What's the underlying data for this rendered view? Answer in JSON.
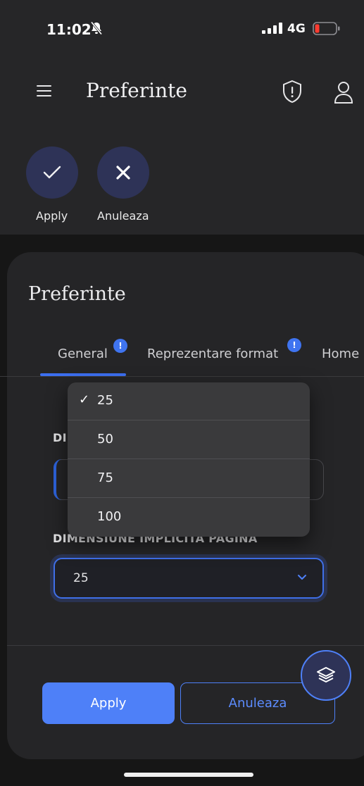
{
  "status_bar": {
    "time": "11:02",
    "network": "4G",
    "bell_icon": "bell-slash-icon",
    "battery_color": "#ff3b30"
  },
  "header": {
    "title": "Preferinte",
    "menu_icon": "hamburger-icon",
    "shield_icon": "shield-exclamation-icon",
    "user_icon": "user-icon"
  },
  "actions": [
    {
      "label": "Apply",
      "icon": "checkmark-icon"
    },
    {
      "label": "Anuleaza",
      "icon": "close-icon"
    }
  ],
  "card": {
    "title": "Preferinte",
    "tabs": [
      {
        "label": "General",
        "badge": "!",
        "active": true
      },
      {
        "label": "Reprezentare format",
        "badge": "!",
        "active": false
      },
      {
        "label": "Home",
        "badge": "",
        "active": false
      }
    ],
    "field1": {
      "label_visible": "DI"
    },
    "field2": {
      "label": "DIMENSIUNE IMPLICITA PAGINA",
      "value": "25"
    }
  },
  "dropdown": {
    "check": "✓",
    "options": [
      {
        "label": "25",
        "selected": true
      },
      {
        "label": "50",
        "selected": false
      },
      {
        "label": "75",
        "selected": false
      },
      {
        "label": "100",
        "selected": false
      }
    ]
  },
  "footer": {
    "apply_label": "Apply",
    "cancel_label": "Anuleaza",
    "fab_icon": "layers-icon"
  },
  "colors": {
    "accent": "#4e80f8",
    "circle_bg": "#2e3357"
  }
}
